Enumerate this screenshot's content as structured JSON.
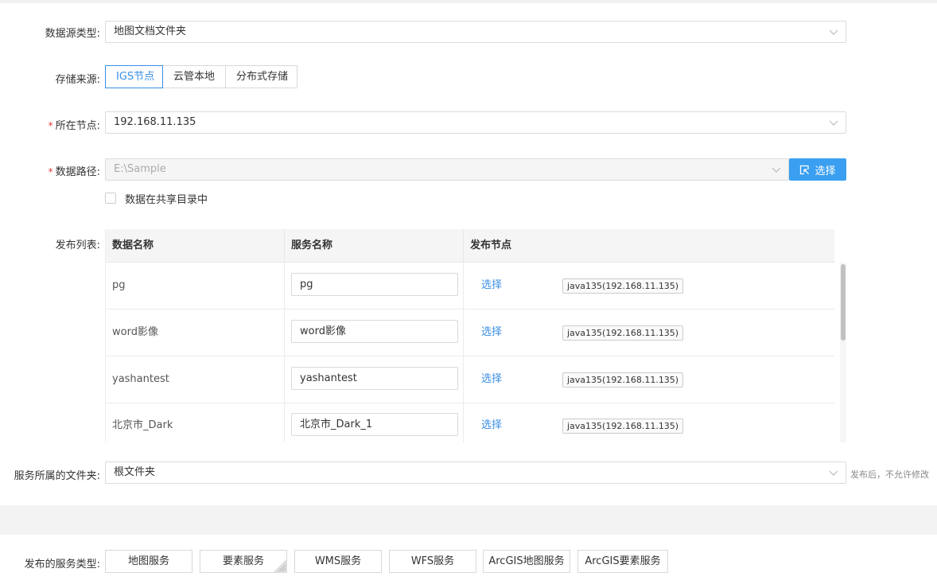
{
  "form": {
    "datasource_type": {
      "label": "数据源类型:",
      "value": "地图文档文件夹"
    },
    "storage_source": {
      "label": "存储来源:",
      "options": [
        "IGS节点",
        "云管本地",
        "分布式存储"
      ],
      "selected": "IGS节点"
    },
    "node": {
      "required_mark": "*",
      "label": "所在节点:",
      "value": "192.168.11.135"
    },
    "data_path": {
      "required_mark": "*",
      "label": "数据路径:",
      "value": "E:\\Sample",
      "pick_button": "选择",
      "pick_icon": "select-icon"
    },
    "shared_dir": {
      "label": "数据在共享目录中",
      "checked": false
    },
    "publish_list": {
      "label": "发布列表:",
      "columns": [
        "数据名称",
        "服务名称",
        "发布节点"
      ],
      "rows": [
        {
          "data_name": "pg",
          "service_name": "pg",
          "action": "选择",
          "node_tag": "java135(192.168.11.135)"
        },
        {
          "data_name": "word影像",
          "service_name": "word影像",
          "action": "选择",
          "node_tag": "java135(192.168.11.135)"
        },
        {
          "data_name": "yashantest",
          "service_name": "yashantest",
          "action": "选择",
          "node_tag": "java135(192.168.11.135)"
        },
        {
          "data_name": "北京市_Dark",
          "service_name": "北京市_Dark_1",
          "action": "选择",
          "node_tag": "java135(192.168.11.135)"
        }
      ]
    },
    "folder": {
      "label": "服务所属的文件夹:",
      "value": "根文件夹",
      "hint": "发布后，不允许修改"
    },
    "service_types": {
      "label": "发布的服务类型:",
      "options": [
        "地图服务",
        "要素服务",
        "WMS服务",
        "WFS服务",
        "ArcGIS地图服务",
        "ArcGIS要素服务"
      ]
    }
  },
  "colors": {
    "primary": "#3a9ff0",
    "link": "#3a8ee6",
    "required": "#e4393c"
  }
}
